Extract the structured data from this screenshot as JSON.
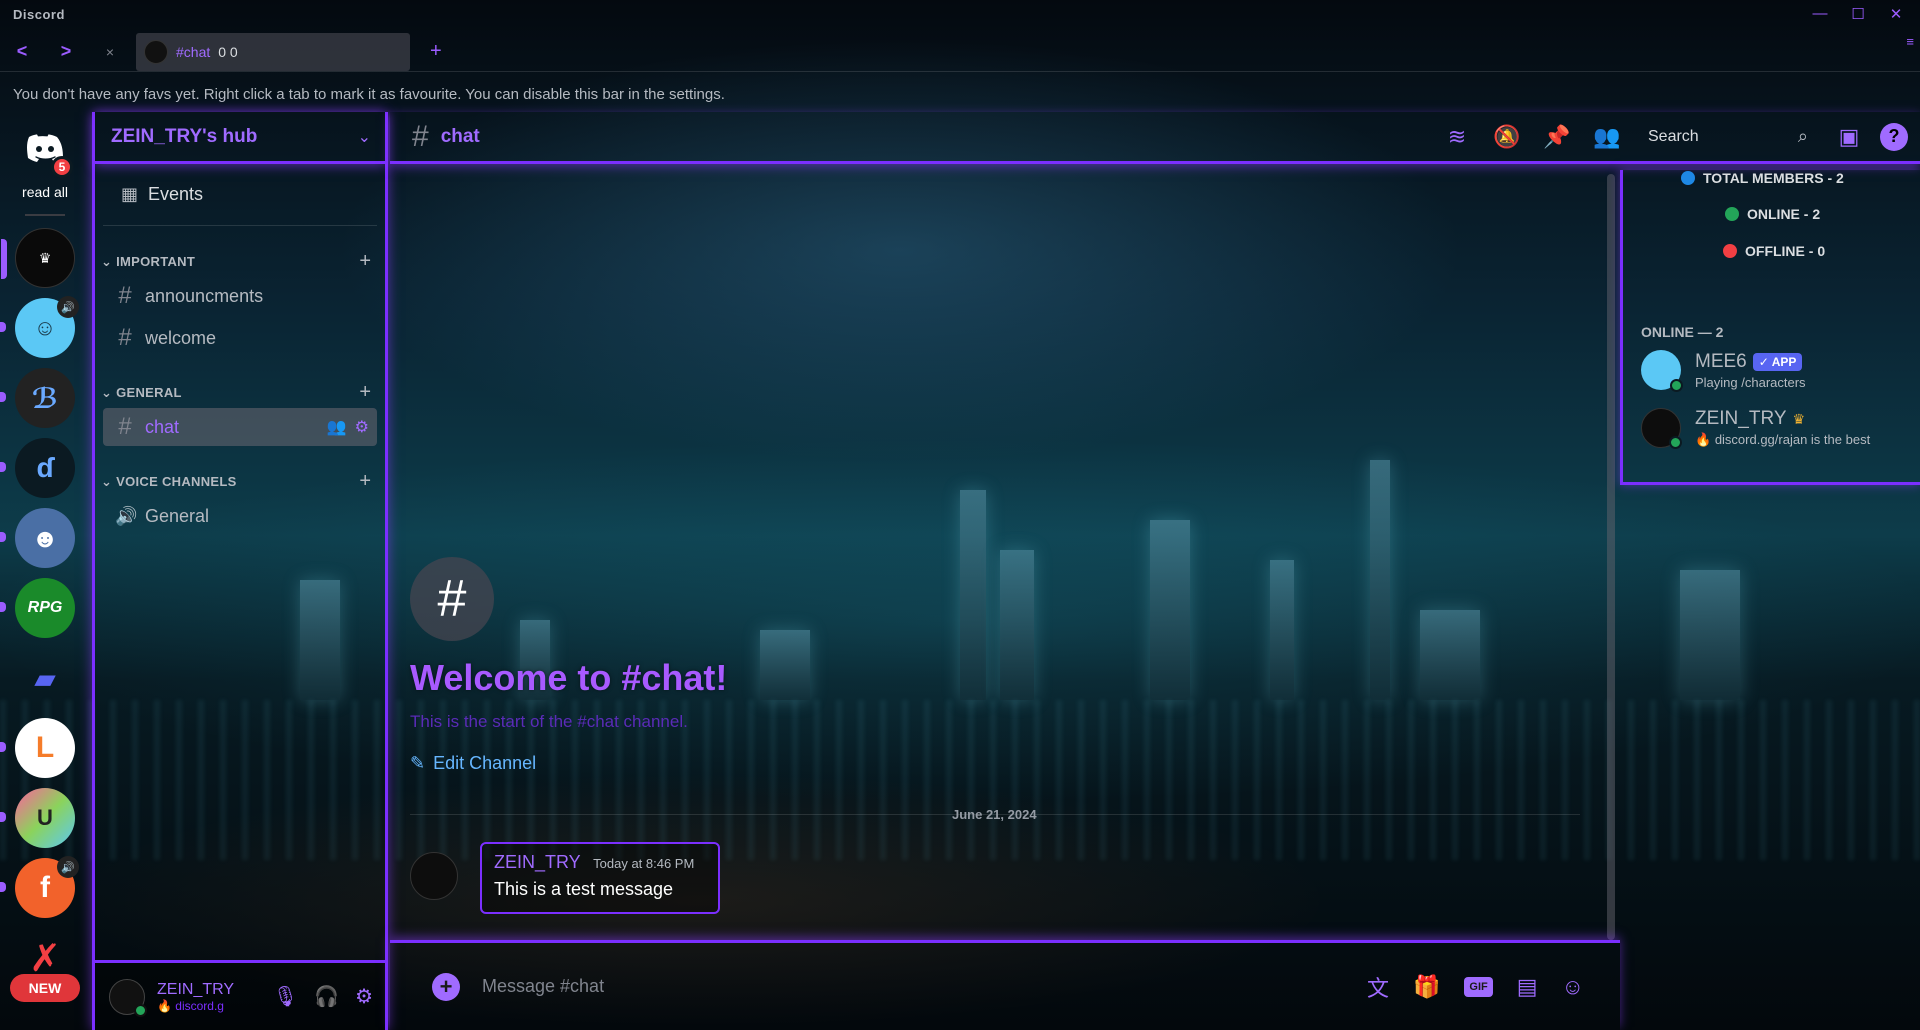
{
  "app": {
    "title": "Discord"
  },
  "window_controls": {
    "minimize": "—",
    "maximize": "☐",
    "close": "✕",
    "menu": "≡"
  },
  "tabbar": {
    "back": "<",
    "forward": ">",
    "close": "×",
    "tab_title": "#chat",
    "tab_counts": "0  0",
    "add": "+"
  },
  "favbar": {
    "text": "You don't have any favs yet. Right click a tab to mark it as favourite. You can disable this bar in the settings."
  },
  "rail": {
    "home_badge": "5",
    "read_all": "read all",
    "new_label": "NEW"
  },
  "guild": {
    "name": "ZEIN_TRY's hub",
    "events_label": "Events",
    "categories": [
      {
        "label": "IMPORTANT",
        "channels": [
          "announcments",
          "welcome"
        ]
      },
      {
        "label": "GENERAL",
        "channels": [
          "chat"
        ]
      },
      {
        "label": "VOICE CHANNELS",
        "channels": [
          "General"
        ]
      }
    ]
  },
  "user": {
    "name": "ZEIN_TRY",
    "status": "discord.g"
  },
  "channel": {
    "name": "chat",
    "search_placeholder": "Search",
    "welcome_title": "Welcome to #chat!",
    "welcome_sub": "This is the start of the #chat channel.",
    "edit_label": "Edit Channel",
    "date_divider": "June 21, 2024",
    "message": {
      "author": "ZEIN_TRY",
      "time": "Today at 8:46 PM",
      "text": "This is a test message"
    },
    "composer_placeholder": "Message #chat",
    "gif_label": "GIF"
  },
  "members": {
    "total": "TOTAL MEMBERS - 2",
    "online": "ONLINE - 2",
    "offline": "OFFLINE - 0",
    "header": "ONLINE — 2",
    "list": [
      {
        "name": "MEE6",
        "badge": "✓ APP",
        "status": "Playing /characters"
      },
      {
        "name": "ZEIN_TRY",
        "status": "discord.gg/rajan is the best"
      }
    ]
  },
  "colors": {
    "accent": "#a06bff",
    "neon": "#7b2fff",
    "online": "#23a559",
    "offline": "#f23f43",
    "total": "#1e88e5"
  }
}
